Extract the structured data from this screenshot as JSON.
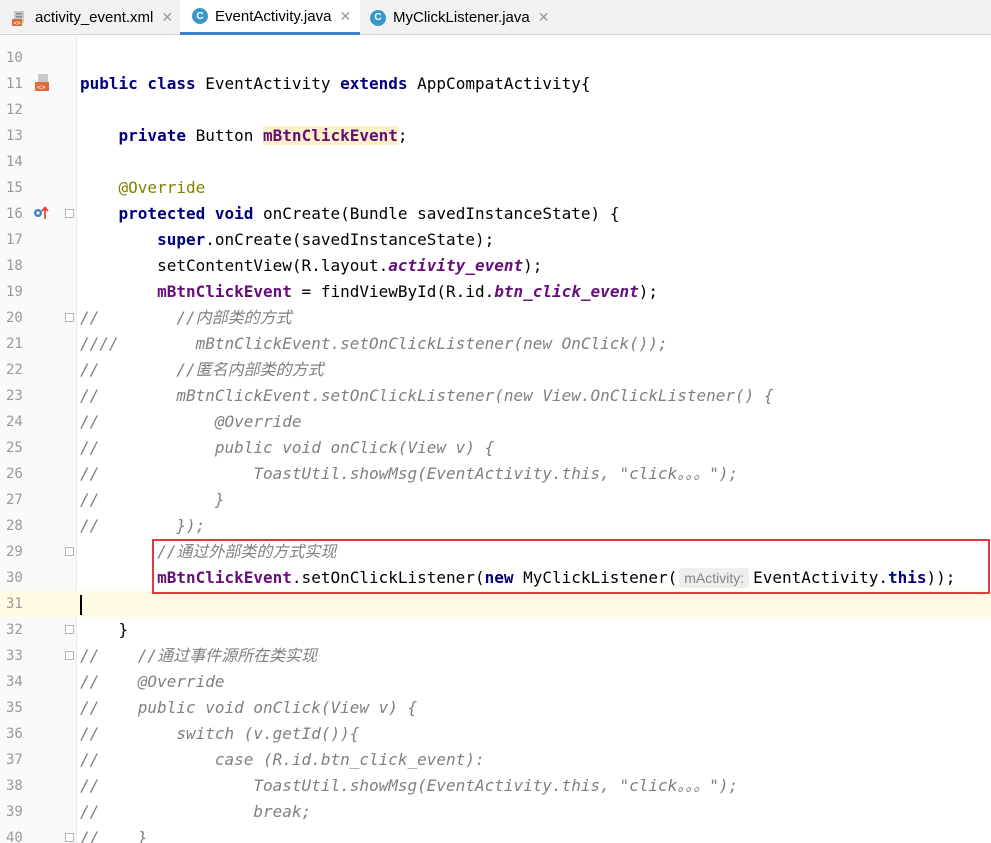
{
  "tabs": [
    {
      "label": "activity_event.xml",
      "type": "xml",
      "active": false
    },
    {
      "label": "EventActivity.java",
      "type": "java",
      "active": true
    },
    {
      "label": "MyClickListener.java",
      "type": "java",
      "active": false
    }
  ],
  "icons": {
    "class_icon": "C",
    "close": "✕"
  },
  "lines": [
    {
      "n": "10",
      "segs": []
    },
    {
      "n": "11",
      "segs": [
        [
          "k",
          "public class "
        ],
        [
          "",
          "EventActivity "
        ],
        [
          "k",
          "extends "
        ],
        [
          "",
          "AppCompatActivity{"
        ]
      ]
    },
    {
      "n": "12",
      "segs": []
    },
    {
      "n": "13",
      "segs": [
        [
          "",
          "    "
        ],
        [
          "k",
          "private "
        ],
        [
          "",
          "Button "
        ],
        [
          "f hl",
          "mBtnClickEvent"
        ],
        [
          "",
          ";"
        ]
      ]
    },
    {
      "n": "14",
      "segs": []
    },
    {
      "n": "15",
      "segs": [
        [
          "",
          "    "
        ],
        [
          "an",
          "@Override"
        ]
      ]
    },
    {
      "n": "16",
      "segs": [
        [
          "",
          "    "
        ],
        [
          "k",
          "protected void "
        ],
        [
          "",
          "onCreate(Bundle savedInstanceState) {"
        ]
      ]
    },
    {
      "n": "17",
      "segs": [
        [
          "",
          "        "
        ],
        [
          "k",
          "super"
        ],
        [
          "",
          ".onCreate(savedInstanceState);"
        ]
      ]
    },
    {
      "n": "18",
      "segs": [
        [
          "",
          "        setContentView(R.layout."
        ],
        [
          "fi",
          "activity_event"
        ],
        [
          "",
          ");"
        ]
      ]
    },
    {
      "n": "19",
      "segs": [
        [
          "",
          "        "
        ],
        [
          "f",
          "mBtnClickEvent"
        ],
        [
          "",
          " = findViewById(R.id."
        ],
        [
          "fi",
          "btn_click_event"
        ],
        [
          "",
          ");"
        ]
      ]
    },
    {
      "n": "20",
      "segs": [
        [
          "c",
          "//        //内部类的方式"
        ]
      ]
    },
    {
      "n": "21",
      "segs": [
        [
          "c",
          "////        mBtnClickEvent.setOnClickListener(new OnClick());"
        ]
      ]
    },
    {
      "n": "22",
      "segs": [
        [
          "c",
          "//        //匿名内部类的方式"
        ]
      ]
    },
    {
      "n": "23",
      "segs": [
        [
          "c",
          "//        mBtnClickEvent.setOnClickListener(new View.OnClickListener() {"
        ]
      ]
    },
    {
      "n": "24",
      "segs": [
        [
          "c",
          "//            @Override"
        ]
      ]
    },
    {
      "n": "25",
      "segs": [
        [
          "c",
          "//            public void onClick(View v) {"
        ]
      ]
    },
    {
      "n": "26",
      "segs": [
        [
          "c",
          "//                ToastUtil.showMsg(EventActivity.this, \"click。。。\");"
        ]
      ]
    },
    {
      "n": "27",
      "segs": [
        [
          "c",
          "//            }"
        ]
      ]
    },
    {
      "n": "28",
      "segs": [
        [
          "c",
          "//        });"
        ]
      ]
    },
    {
      "n": "29",
      "segs": [
        [
          "",
          "        "
        ],
        [
          "c",
          "//通过外部类的方式实现"
        ]
      ]
    },
    {
      "n": "30",
      "segs": [
        [
          "",
          "        "
        ],
        [
          "f",
          "mBtnClickEvent"
        ],
        [
          "",
          ".setOnClickListener("
        ],
        [
          "k",
          "new "
        ],
        [
          "",
          "MyClickListener("
        ],
        [
          "hint",
          "mActivity:"
        ],
        [
          "",
          "EventActivity."
        ],
        [
          "k",
          "this"
        ],
        [
          "",
          "));"
        ]
      ]
    },
    {
      "n": "31",
      "segs": []
    },
    {
      "n": "32",
      "segs": [
        [
          "",
          "    }"
        ]
      ]
    },
    {
      "n": "33",
      "segs": [
        [
          "c",
          "//    //通过事件源所在类实现"
        ]
      ]
    },
    {
      "n": "34",
      "segs": [
        [
          "c",
          "//    @Override"
        ]
      ]
    },
    {
      "n": "35",
      "segs": [
        [
          "c",
          "//    public void onClick(View v) {"
        ]
      ]
    },
    {
      "n": "36",
      "segs": [
        [
          "c",
          "//        switch (v.getId()){"
        ]
      ]
    },
    {
      "n": "37",
      "segs": [
        [
          "c",
          "//            case (R.id.btn_click_event):"
        ]
      ]
    },
    {
      "n": "38",
      "segs": [
        [
          "c",
          "//                ToastUtil.showMsg(EventActivity.this, \"click。。。\");"
        ]
      ]
    },
    {
      "n": "39",
      "segs": [
        [
          "c",
          "//                break;"
        ]
      ]
    },
    {
      "n": "40",
      "segs": [
        [
          "c",
          "//    }"
        ]
      ]
    }
  ]
}
